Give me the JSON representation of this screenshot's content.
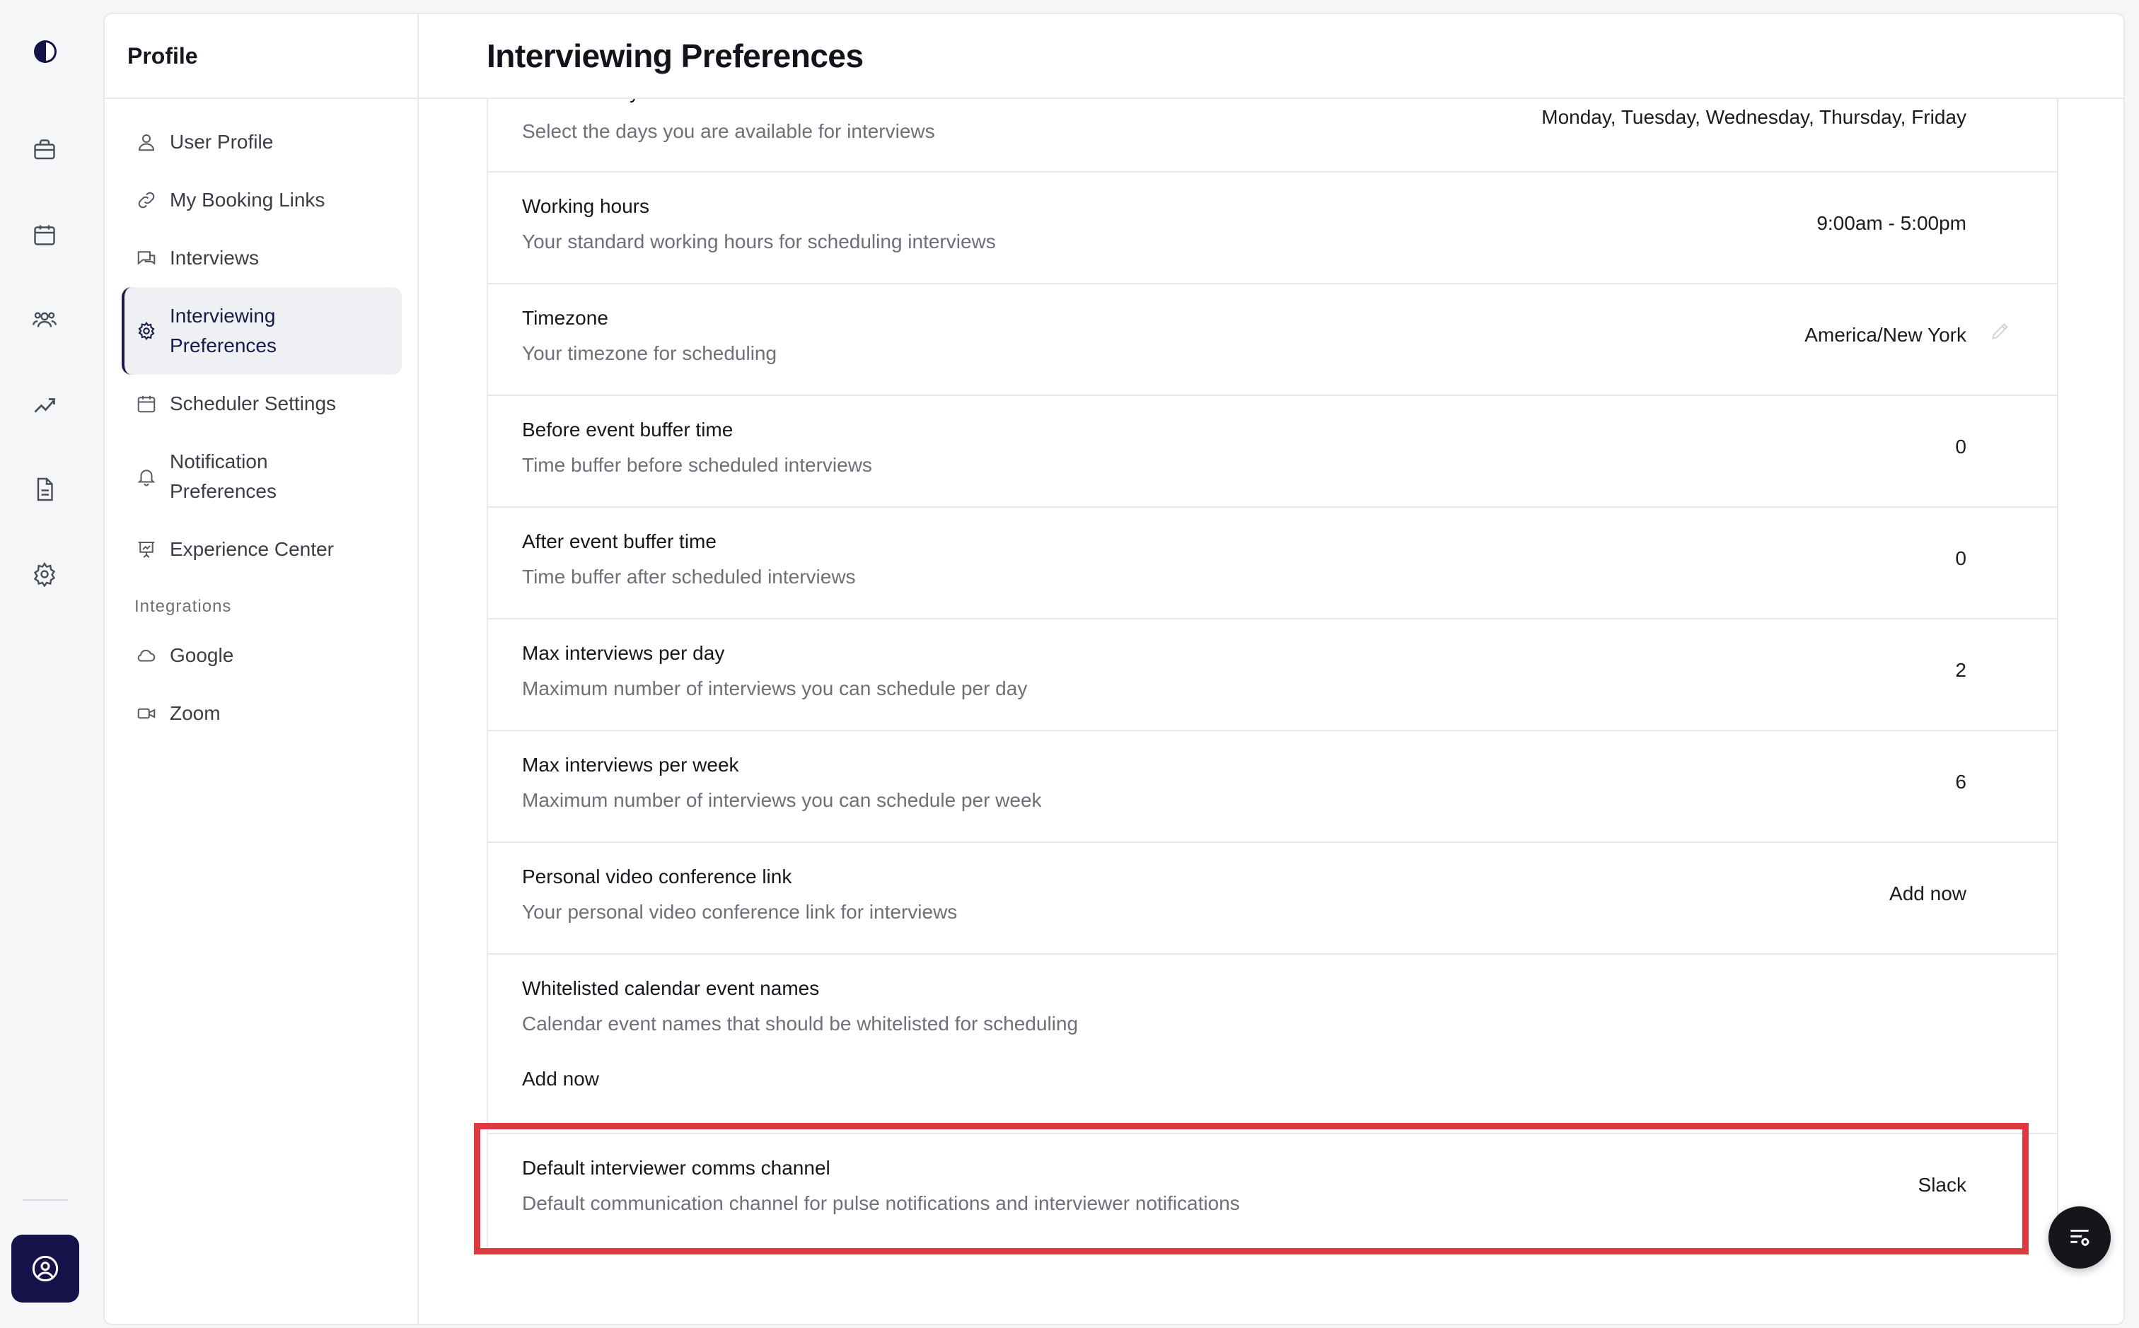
{
  "colors": {
    "brand": "#17124a",
    "highlight": "#e0383f",
    "active_bg": "#eef0f4"
  },
  "rail": {
    "logo": "brand-logo",
    "icons": [
      "briefcase-icon",
      "calendar-icon",
      "people-icon",
      "analytics-icon",
      "document-icon",
      "gear-icon"
    ],
    "user_icon": "user-circle-icon"
  },
  "sidebar": {
    "title": "Profile",
    "items": [
      {
        "label": "User Profile",
        "icon": "user-icon"
      },
      {
        "label": "My Booking Links",
        "icon": "link-icon"
      },
      {
        "label": "Interviews",
        "icon": "chat-icon"
      },
      {
        "label": "Interviewing Preferences",
        "icon": "gear-icon",
        "active": true
      },
      {
        "label": "Scheduler Settings",
        "icon": "calendar-icon"
      },
      {
        "label": "Notification Preferences",
        "icon": "bell-icon"
      },
      {
        "label": "Experience Center",
        "icon": "presentation-icon"
      }
    ],
    "integrations_heading": "Integrations",
    "integrations": [
      {
        "label": "Google",
        "icon": "cloud-icon"
      },
      {
        "label": "Zoom",
        "icon": "video-icon"
      }
    ]
  },
  "page": {
    "title": "Interviewing Preferences",
    "rows": [
      {
        "title": "Available days",
        "desc": "Select the days you are available for interviews",
        "value": "Monday, Tuesday, Wednesday, Thursday, Friday"
      },
      {
        "title": "Working hours",
        "desc": "Your standard working hours for scheduling interviews",
        "value": "9:00am - 5:00pm"
      },
      {
        "title": "Timezone",
        "desc": "Your timezone for scheduling",
        "value": "America/New York"
      },
      {
        "title": "Before event buffer time",
        "desc": "Time buffer before scheduled interviews",
        "value": "0"
      },
      {
        "title": "After event buffer time",
        "desc": "Time buffer after scheduled interviews",
        "value": "0"
      },
      {
        "title": "Max interviews per day",
        "desc": "Maximum number of interviews you can schedule per day",
        "value": "2"
      },
      {
        "title": "Max interviews per week",
        "desc": "Maximum number of interviews you can schedule per week",
        "value": "6"
      },
      {
        "title": "Personal video conference link",
        "desc": "Your personal video conference link for interviews",
        "value": "Add now"
      },
      {
        "title": "Whitelisted calendar event names",
        "desc": "Calendar event names that should be whitelisted for scheduling",
        "action": "Add now"
      },
      {
        "title": "Default interviewer comms channel",
        "desc": "Default communication channel for pulse notifications and interviewer notifications",
        "value": "Slack"
      }
    ]
  },
  "fab": {
    "icon": "list-settings-icon"
  }
}
